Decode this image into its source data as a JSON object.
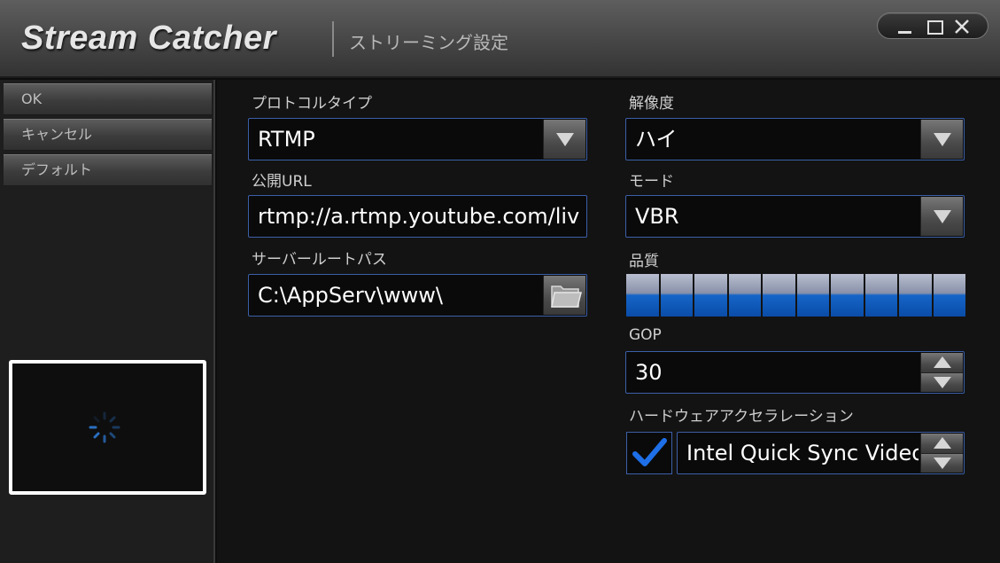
{
  "app": {
    "title": "Stream Catcher",
    "subtitle": "ストリーミング設定"
  },
  "sidebar": {
    "ok_label": "OK",
    "cancel_label": "キャンセル",
    "default_label": "デフォルト"
  },
  "form": {
    "protocol": {
      "label": "プロトコルタイプ",
      "value": "RTMP"
    },
    "public_url": {
      "label": "公開URL",
      "value": "rtmp://a.rtmp.youtube.com/liv"
    },
    "server_root": {
      "label": "サーバールートパス",
      "value": "C:\\AppServ\\www\\"
    },
    "resolution": {
      "label": "解像度",
      "value": "ハイ"
    },
    "mode": {
      "label": "モード",
      "value": "VBR"
    },
    "quality": {
      "label": "品質",
      "level_fraction": 1.0,
      "segments": 10
    },
    "gop": {
      "label": "GOP",
      "value": "30"
    },
    "hw_accel": {
      "label": "ハードウェアアクセラレーション",
      "checked": true,
      "value": "Intel Quick Sync Video"
    }
  },
  "colors": {
    "accent_blue": "#1565c8",
    "field_border": "#3c5fa8",
    "check_blue": "#1e6fe8"
  },
  "icons": {
    "dropdown": "chevron-down-icon",
    "folder": "folder-icon",
    "spinner": "loading-spinner-icon",
    "check": "checkmark-icon"
  }
}
